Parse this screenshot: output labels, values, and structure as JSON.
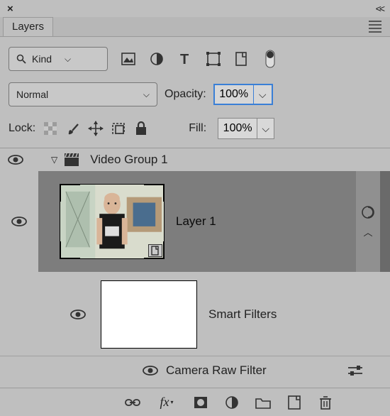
{
  "panel": {
    "tab": "Layers"
  },
  "filter": {
    "kind_label": "Kind"
  },
  "blend": {
    "mode": "Normal",
    "opacity_label": "Opacity:",
    "opacity_value": "100%"
  },
  "lock": {
    "label": "Lock:",
    "fill_label": "Fill:",
    "fill_value": "100%"
  },
  "layers": {
    "group_name": "Video Group 1",
    "layer1_name": "Layer 1",
    "smart_filters_label": "Smart Filters",
    "filter1_name": "Camera Raw Filter"
  }
}
